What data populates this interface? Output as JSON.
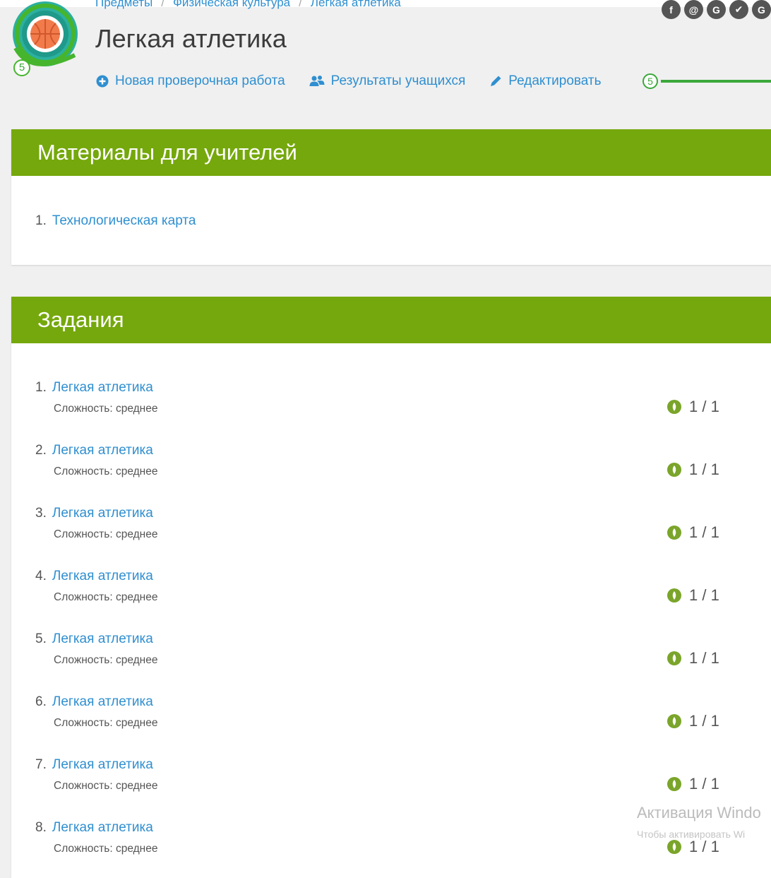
{
  "breadcrumb": [
    "Предметы",
    "Физическая культура",
    "Легкая атлетика"
  ],
  "social": [
    "f",
    "@",
    "G",
    "✔",
    "G"
  ],
  "logo_level": "5",
  "page_title": "Легкая атлетика",
  "actions": {
    "new_test": "Новая проверочная работа",
    "results": "Результаты учащихся",
    "edit": "Редактировать"
  },
  "level_indicator": "5",
  "materials": {
    "title": "Материалы для учителей",
    "items": [
      {
        "num": "1.",
        "label": "Технологическая карта"
      }
    ]
  },
  "tasks": {
    "title": "Задания",
    "items": [
      {
        "num": "1.",
        "label": "Легкая атлетика",
        "difficulty": "Сложность: среднее",
        "score": "1 / 1"
      },
      {
        "num": "2.",
        "label": "Легкая атлетика",
        "difficulty": "Сложность: среднее",
        "score": "1 / 1"
      },
      {
        "num": "3.",
        "label": "Легкая атлетика",
        "difficulty": "Сложность: среднее",
        "score": "1 / 1"
      },
      {
        "num": "4.",
        "label": "Легкая атлетика",
        "difficulty": "Сложность: среднее",
        "score": "1 / 1"
      },
      {
        "num": "5.",
        "label": "Легкая атлетика",
        "difficulty": "Сложность: среднее",
        "score": "1 / 1"
      },
      {
        "num": "6.",
        "label": "Легкая атлетика",
        "difficulty": "Сложность: среднее",
        "score": "1 / 1"
      },
      {
        "num": "7.",
        "label": "Легкая атлетика",
        "difficulty": "Сложность: среднее",
        "score": "1 / 1"
      },
      {
        "num": "8.",
        "label": "Легкая атлетика",
        "difficulty": "Сложность: среднее",
        "score": "1 / 1"
      }
    ]
  },
  "watermark": {
    "line1": "Активация Windo",
    "line2": "Чтобы активировать Wi"
  },
  "colors": {
    "header_green": "#75a80c",
    "link_blue": "#2f8fd0",
    "progress_green": "#3aa83a"
  }
}
